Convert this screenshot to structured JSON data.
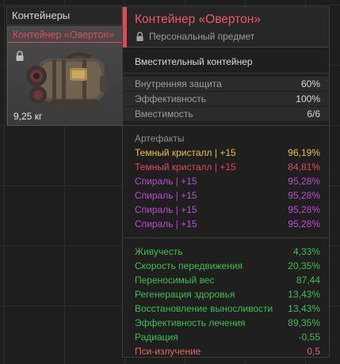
{
  "inventory": {
    "header": "Контейнеры",
    "item": {
      "name": "Контейнер «Овертон»",
      "weight": "9,25 кг"
    }
  },
  "tooltip": {
    "title": "Контейнер «Овертон»",
    "subtitle": "Персональный предмет",
    "description": "Вместительный контейнер",
    "properties": [
      {
        "label": "Внутренняя защита",
        "value": "60%"
      },
      {
        "label": "Эффективность",
        "value": "100%"
      },
      {
        "label": "Вместимость",
        "value": "6/6"
      }
    ],
    "artifacts_heading": "Артефакты",
    "artifacts": [
      {
        "label": "Темный кристалл | +15",
        "value": "96,19%",
        "color": "#e8c43c"
      },
      {
        "label": "Темный кристалл | +15",
        "value": "84,81%",
        "color": "#e04a56"
      },
      {
        "label": "Спираль | +15",
        "value": "95,28%",
        "color": "#c04bd0"
      },
      {
        "label": "Спираль | +15",
        "value": "95,28%",
        "color": "#c04bd0"
      },
      {
        "label": "Спираль | +15",
        "value": "95,28%",
        "color": "#c04bd0"
      },
      {
        "label": "Спираль | +15",
        "value": "95,28%",
        "color": "#c04bd0"
      }
    ],
    "effects": [
      {
        "label": "Живучесть",
        "value": "4,33%",
        "color": "#3fbf4f"
      },
      {
        "label": "Скорость передвижения",
        "value": "20,35%",
        "color": "#3fbf4f"
      },
      {
        "label": "Переносимый вес",
        "value": "87,44",
        "color": "#3fbf4f"
      },
      {
        "label": "Регенерация здоровья",
        "value": "13,43%",
        "color": "#3fbf4f"
      },
      {
        "label": "Восстановление выносливости",
        "value": "13,43%",
        "color": "#3fbf4f"
      },
      {
        "label": "Эффективность лечения",
        "value": "89,35%",
        "color": "#3fbf4f"
      },
      {
        "label": "Радиация",
        "value": "-0,55",
        "color": "#3fbf4f"
      },
      {
        "label": "Пси-излучение",
        "value": "0,5",
        "color": "#e26a5c"
      }
    ]
  },
  "colors": {
    "accent": "#e04a56",
    "positive": "#3fbf4f",
    "negative": "#e26a5c",
    "legendary": "#e8c43c",
    "epic": "#c04bd0"
  }
}
